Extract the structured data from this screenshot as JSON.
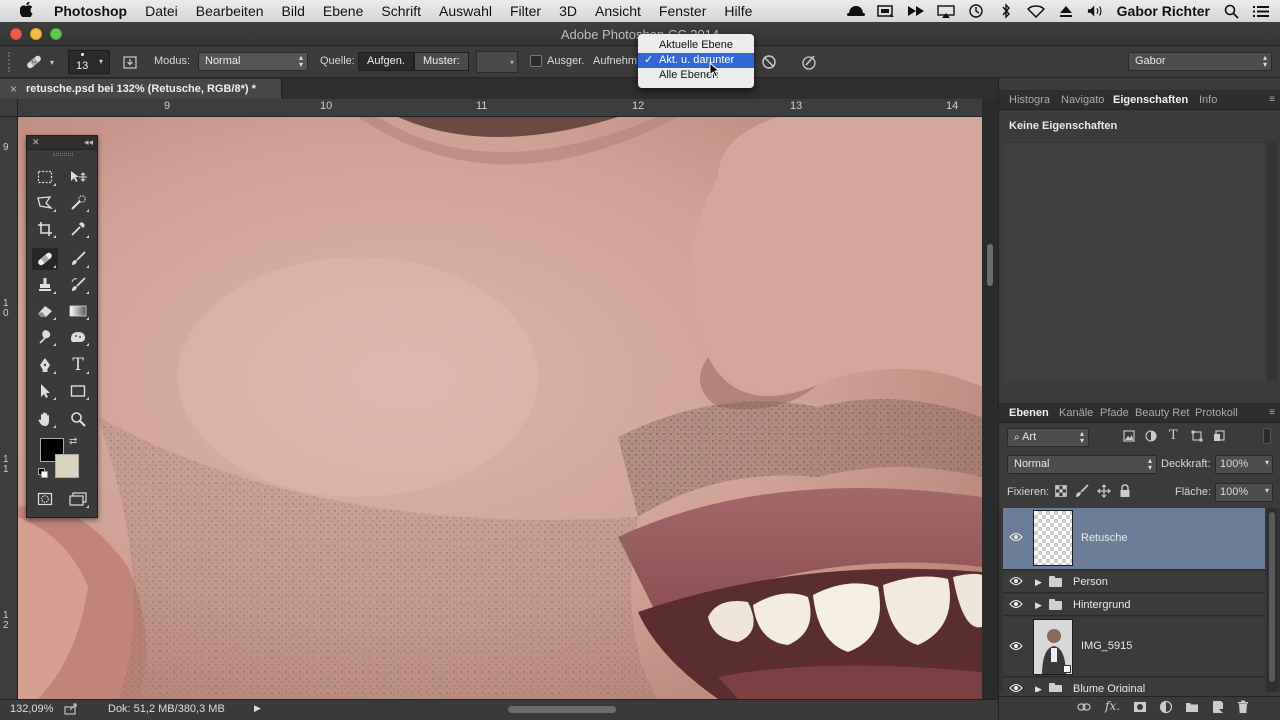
{
  "menubar": {
    "apple": "",
    "app": "Photoshop",
    "items": [
      "Datei",
      "Bearbeiten",
      "Bild",
      "Ebene",
      "Schrift",
      "Auswahl",
      "Filter",
      "3D",
      "Ansicht",
      "Fenster",
      "Hilfe"
    ],
    "user": "Gabor Richter"
  },
  "window": {
    "title": "Adobe Photoshop CC 2014"
  },
  "options": {
    "brush_size": "13",
    "mode_label": "Modus:",
    "mode_value": "Normal",
    "source_label": "Quelle:",
    "source_sampled": "Aufgen.",
    "source_pattern": "Muster:",
    "aligned_label": "Ausger.",
    "sample_label": "Aufnehm.",
    "workspace": "Gabor"
  },
  "sample_dropdown": {
    "items": [
      "Aktuelle Ebene",
      "Akt. u. darunter",
      "Alle Ebenen"
    ],
    "selected_index": 1,
    "check": "✓"
  },
  "document": {
    "tab_title": "retusche.psd bei 132% (Retusche, RGB/8*) *",
    "close": "×"
  },
  "rulers": {
    "h_labels": [
      "9",
      "10",
      "11",
      "12",
      "13",
      "14"
    ],
    "v_labels": [
      "9",
      "1 0",
      "1 1",
      "1 2"
    ]
  },
  "status": {
    "zoom": "132,09%",
    "doc": "Dok: 51,2 MB/380,3 MB"
  },
  "panels": {
    "top_tabs": [
      "Histogra",
      "Navigato",
      "Eigenschaften",
      "Info"
    ],
    "top_active": 2,
    "properties_text": "Keine Eigenschaften",
    "layer_tabs": [
      "Ebenen",
      "Kanäle",
      "Pfade",
      "Beauty Ret",
      "Protokoll"
    ],
    "layer_active": 0,
    "filter_kind": "Art",
    "blend_mode": "Normal",
    "opacity_label": "Deckkraft:",
    "opacity_value": "100%",
    "lock_label": "Fixieren:",
    "fill_label": "Fläche:",
    "fill_value": "100%"
  },
  "layers": [
    {
      "name": "Retusche",
      "type": "pixel",
      "selected": true
    },
    {
      "name": "Person",
      "type": "group",
      "selected": false
    },
    {
      "name": "Hintergrund",
      "type": "group",
      "selected": false
    },
    {
      "name": "IMG_5915",
      "type": "smart",
      "selected": false
    },
    {
      "name": "Blume Original",
      "type": "group",
      "selected": false
    }
  ],
  "colors": {
    "accent": "#3069d6",
    "selected_layer": "#6b7d99",
    "foreground": "#000000",
    "background": "#d8d4c0"
  }
}
